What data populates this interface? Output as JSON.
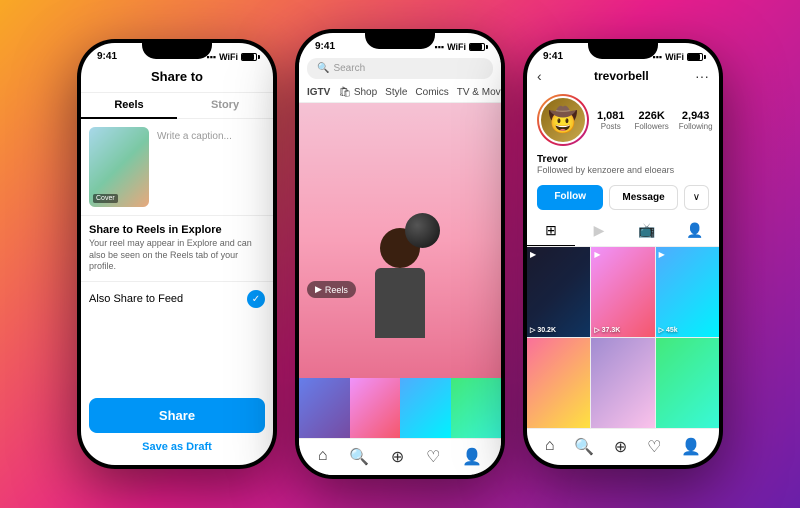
{
  "background": "linear-gradient(135deg, #f9a825 0%, #e91e8c 50%, #6a1fa8 100%)",
  "phone1": {
    "status_time": "9:41",
    "header_title": "Share to",
    "tab_reels": "Reels",
    "tab_story": "Story",
    "caption_placeholder": "Write a caption...",
    "cover_label": "Cover",
    "option_title": "Share to Reels in Explore",
    "option_desc": "Your reel may appear in Explore and can also be seen on the Reels tab of your profile.",
    "feed_label": "Also Share to Feed",
    "share_btn": "Share",
    "save_draft_label": "Save as Draft"
  },
  "phone2": {
    "status_time": "9:41",
    "search_placeholder": "Search",
    "categories": [
      "IGTV",
      "Shop",
      "Style",
      "Comics",
      "TV & Movi..."
    ],
    "reels_label": "Reels",
    "nav_icons": [
      "home",
      "search",
      "add",
      "heart",
      "person"
    ]
  },
  "phone3": {
    "status_time": "9:41",
    "username": "trevorbell",
    "posts_count": "1,081",
    "posts_label": "Posts",
    "followers_count": "226K",
    "followers_label": "Followers",
    "following_count": "2,943",
    "following_label": "Following",
    "bio_name": "Trevor",
    "bio_followed": "Followed by kenzoere and eloears",
    "follow_btn": "Follow",
    "message_btn": "Message",
    "grid_items": [
      {
        "count": "▷ 30.2K"
      },
      {
        "count": "▷ 37.3K"
      },
      {
        "count": "▷ 45k"
      },
      {
        "count": ""
      },
      {
        "count": ""
      },
      {
        "count": ""
      }
    ],
    "nav_icons": [
      "home",
      "search",
      "add",
      "heart",
      "person"
    ]
  }
}
